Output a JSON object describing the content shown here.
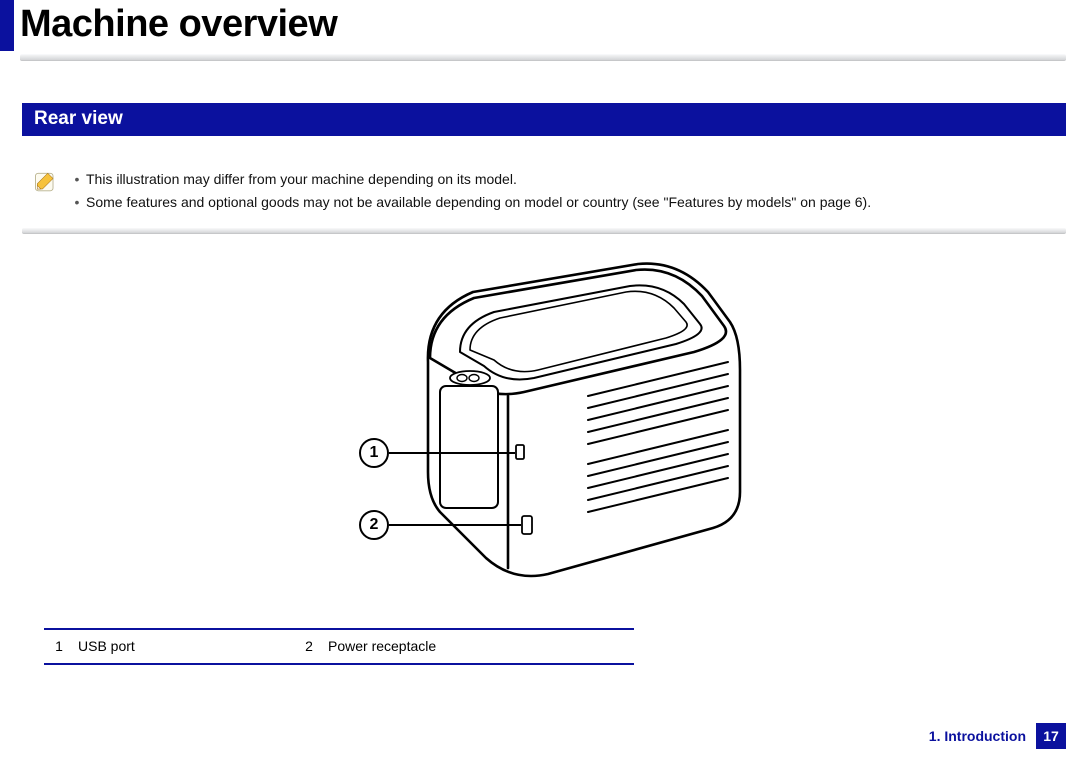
{
  "title": "Machine overview",
  "section": {
    "heading": "Rear view"
  },
  "notes": {
    "icon_name": "note-pencil-icon",
    "items": [
      "This illustration may differ from your machine depending on its model.",
      "Some features and optional goods may not be available depending on model or country (see \"Features by models\" on page 6)."
    ]
  },
  "diagram": {
    "callouts": [
      {
        "n": "1",
        "label": "USB port"
      },
      {
        "n": "2",
        "label": "Power receptacle"
      }
    ]
  },
  "parts_table": {
    "rows": [
      {
        "n": "1",
        "label": "USB port"
      },
      {
        "n": "2",
        "label": "Power receptacle"
      }
    ]
  },
  "footer": {
    "chapter": "1. Introduction",
    "page": "17"
  }
}
